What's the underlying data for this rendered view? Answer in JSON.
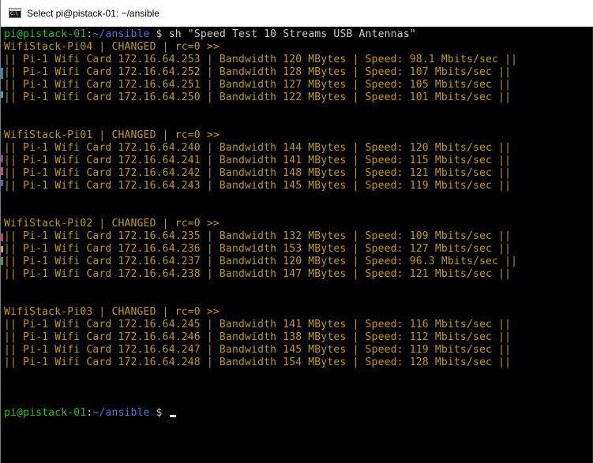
{
  "window": {
    "title": "Select pi@pistack-01: ~/ansible",
    "icon": "console-icon",
    "icon_text": "C:\\"
  },
  "colors": {
    "background": "#000000",
    "output_text": "#c19c00",
    "prompt_user": "#16c60c",
    "prompt_path": "#3b78ff",
    "command_text": "#cccccc"
  },
  "terminal": {
    "command_line": {
      "user_host": "pi@pistack-01",
      "path": "~/ansible",
      "symbol": " $",
      "command": " sh \"Speed Test 10 Streams USB Antennas\""
    },
    "line_1": "WifiStack-Pi04 | CHANGED | rc=0 >>",
    "line_2": "|| Pi-1 Wifi Card 172.16.64.253 | Bandwidth 120 MBytes | Speed: 98.1 Mbits/sec ||",
    "line_3": "|| Pi-1 Wifi Card 172.16.64.252 | Bandwidth 128 MBytes | Speed: 107 Mbits/sec ||",
    "line_4": "|| Pi-1 Wifi Card 172.16.64.251 | Bandwidth 127 MBytes | Speed: 105 Mbits/sec ||",
    "line_5": "|| Pi-1 Wifi Card 172.16.64.250 | Bandwidth 122 MBytes | Speed: 101 Mbits/sec ||",
    "line_8": "WifiStack-Pi01 | CHANGED | rc=0 >>",
    "line_9": "|| Pi-1 Wifi Card 172.16.64.240 | Bandwidth 144 MBytes | Speed: 120 Mbits/sec ||",
    "line_10": "|| Pi-1 Wifi Card 172.16.64.241 | Bandwidth 141 MBytes | Speed: 115 Mbits/sec ||",
    "line_11": "|| Pi-1 Wifi Card 172.16.64.242 | Bandwidth 148 MBytes | Speed: 121 Mbits/sec ||",
    "line_12": "|| Pi-1 Wifi Card 172.16.64.243 | Bandwidth 145 MBytes | Speed: 119 Mbits/sec ||",
    "line_15": "WifiStack-Pi02 | CHANGED | rc=0 >>",
    "line_16": "|| Pi-1 Wifi Card 172.16.64.235 | Bandwidth 132 MBytes | Speed: 109 Mbits/sec ||",
    "line_17": "|| Pi-1 Wifi Card 172.16.64.236 | Bandwidth 153 MBytes | Speed: 127 Mbits/sec ||",
    "line_18": "|| Pi-1 Wifi Card 172.16.64.237 | Bandwidth 120 MBytes | Speed: 96.3 Mbits/sec ||",
    "line_19": "|| Pi-1 Wifi Card 172.16.64.238 | Bandwidth 147 MBytes | Speed: 121 Mbits/sec ||",
    "line_22": "WifiStack-Pi03 | CHANGED | rc=0 >>",
    "line_23": "|| Pi-1 Wifi Card 172.16.64.245 | Bandwidth 141 MBytes | Speed: 116 Mbits/sec ||",
    "line_24": "|| Pi-1 Wifi Card 172.16.64.246 | Bandwidth 138 MBytes | Speed: 112 Mbits/sec ||",
    "line_25": "|| Pi-1 Wifi Card 172.16.64.247 | Bandwidth 145 MBytes | Speed: 119 Mbits/sec ||",
    "line_26": "|| Pi-1 Wifi Card 172.16.64.248 | Bandwidth 154 MBytes | Speed: 128 Mbits/sec ||",
    "final_prompt": {
      "user_host": "pi@pistack-01",
      "path": "~/ansible",
      "symbol": " $ "
    }
  }
}
